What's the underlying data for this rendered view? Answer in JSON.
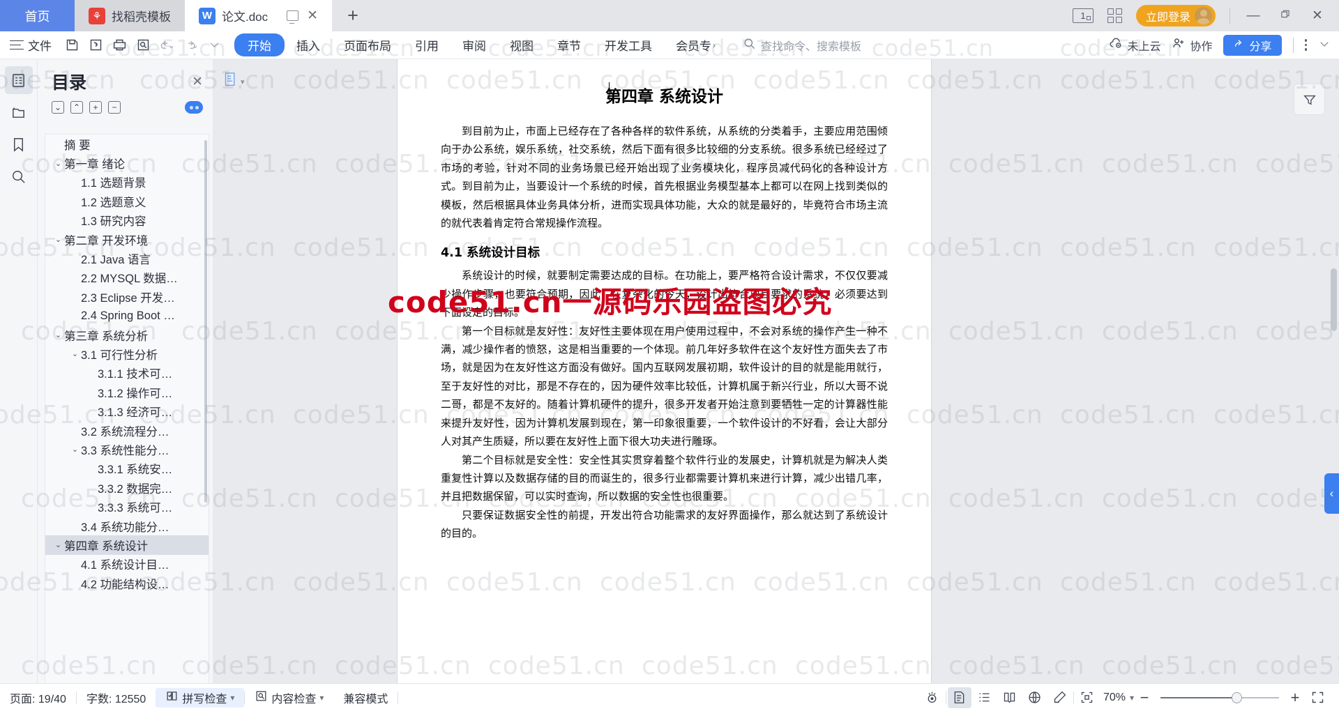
{
  "window": {
    "tabs": [
      {
        "label": "首页",
        "type": "home",
        "icon": "home-tab"
      },
      {
        "label": "找稻壳模板",
        "type": "inactive",
        "icon": "docer-icon"
      },
      {
        "label": "论文.doc",
        "type": "active",
        "icon": "wps-writer-icon"
      }
    ],
    "new_tab_label": "+",
    "close_label": "✕",
    "login_button": "立即登录",
    "minimize": "—",
    "restore": "❐",
    "close": "✕",
    "page_count_badge": "1"
  },
  "ribbon": {
    "file_label": "文件",
    "quick_icons": [
      "save-icon",
      "cloud-save-icon",
      "print-icon",
      "print-preview-icon",
      "undo-icon",
      "redo-icon",
      "customize-icon"
    ],
    "menus": [
      {
        "label": "开始",
        "active": true
      },
      {
        "label": "插入",
        "active": false
      },
      {
        "label": "页面布局",
        "active": false
      },
      {
        "label": "引用",
        "active": false
      },
      {
        "label": "审阅",
        "active": false
      },
      {
        "label": "视图",
        "active": false
      },
      {
        "label": "章节",
        "active": false
      },
      {
        "label": "开发工具",
        "active": false
      },
      {
        "label": "会员专",
        "active": false
      }
    ],
    "search_placeholder": "查找命令、搜索模板",
    "cloud_status": "未上云",
    "collab_label": "协作",
    "share_label": "分享"
  },
  "rail": {
    "items": [
      {
        "name": "document-outline",
        "icon": "outline-icon",
        "active": true
      },
      {
        "name": "thumbnail-pane",
        "icon": "thumbnail-icon",
        "active": false
      },
      {
        "name": "bookmark-pane",
        "icon": "bookmark-icon",
        "active": false
      },
      {
        "name": "search-pane",
        "icon": "search-icon",
        "active": false
      }
    ]
  },
  "toc": {
    "title": "目录",
    "close_label": "✕",
    "tools": [
      {
        "name": "expand-down-button",
        "glyph": "⌄"
      },
      {
        "name": "collapse-up-button",
        "glyph": "⌃"
      },
      {
        "name": "expand-all-button",
        "glyph": "+"
      },
      {
        "name": "collapse-all-button",
        "glyph": "−"
      }
    ],
    "items": [
      {
        "label": "摘  要",
        "level": 1,
        "caret": "",
        "selected": false
      },
      {
        "label": "第一章 绪论",
        "level": 1,
        "caret": "⌄",
        "selected": false
      },
      {
        "label": "1.1 选题背景",
        "level": 2,
        "caret": "",
        "selected": false
      },
      {
        "label": "1.2 选题意义",
        "level": 2,
        "caret": "",
        "selected": false
      },
      {
        "label": "1.3 研究内容",
        "level": 2,
        "caret": "",
        "selected": false
      },
      {
        "label": "第二章 开发环境",
        "level": 1,
        "caret": "⌄",
        "selected": false
      },
      {
        "label": "2.1 Java 语言",
        "level": 2,
        "caret": "",
        "selected": false
      },
      {
        "label": "2.2 MYSQL 数据…",
        "level": 2,
        "caret": "",
        "selected": false
      },
      {
        "label": "2.3 Eclipse 开发…",
        "level": 2,
        "caret": "",
        "selected": false
      },
      {
        "label": "2.4 Spring Boot …",
        "level": 2,
        "caret": "",
        "selected": false
      },
      {
        "label": "第三章 系统分析",
        "level": 1,
        "caret": "⌄",
        "selected": false
      },
      {
        "label": "3.1 可行性分析",
        "level": 2,
        "caret": "⌄",
        "selected": false
      },
      {
        "label": "3.1.1 技术可…",
        "level": 3,
        "caret": "",
        "selected": false
      },
      {
        "label": "3.1.2 操作可…",
        "level": 3,
        "caret": "",
        "selected": false
      },
      {
        "label": "3.1.3 经济可…",
        "level": 3,
        "caret": "",
        "selected": false
      },
      {
        "label": "3.2 系统流程分…",
        "level": 2,
        "caret": "",
        "selected": false
      },
      {
        "label": "3.3 系统性能分…",
        "level": 2,
        "caret": "⌄",
        "selected": false
      },
      {
        "label": "3.3.1 系统安…",
        "level": 3,
        "caret": "",
        "selected": false
      },
      {
        "label": "3.3.2 数据完…",
        "level": 3,
        "caret": "",
        "selected": false
      },
      {
        "label": "3.3.3 系统可…",
        "level": 3,
        "caret": "",
        "selected": false
      },
      {
        "label": "3.4 系统功能分…",
        "level": 2,
        "caret": "",
        "selected": false
      },
      {
        "label": "第四章 系统设计",
        "level": 1,
        "caret": "⌄",
        "selected": true
      },
      {
        "label": "4.1 系统设计目…",
        "level": 2,
        "caret": "",
        "selected": false
      },
      {
        "label": "4.2 功能结构设…",
        "level": 2,
        "caret": "",
        "selected": false
      }
    ]
  },
  "document": {
    "heading1": "第四章  系统设计",
    "paragraphs": [
      "到目前为止，市面上已经存在了各种各样的软件系统，从系统的分类着手，主要应用范围倾向于办公系统，娱乐系统，社交系统，然后下面有很多比较细的分支系统。很多系统已经经过了市场的考验，针对不同的业务场景已经开始出现了业务模块化，程序员减代码化的各种设计方式。到目前为止，当要设计一个系统的时候，首先根据业务模型基本上都可以在网上找到类似的模板，然后根据具体业务具体分析，进而实现具体功能，大众的就是最好的，毕竟符合市场主流的就代表着肯定符合常规操作流程。"
    ],
    "heading2": "4.1  系统设计目标",
    "paragraphs2": [
      "系统设计的时候，就要制定需要达成的目标。在功能上，要严格符合设计需求，不仅仅要减少操作步骤，也要符合预期，因此，在复杂化的今天，设计出符合项目要求的系统，必须要达到下面设定的目标。",
      "第一个目标就是友好性：友好性主要体现在用户使用过程中，不会对系统的操作产生一种不满，减少操作者的愤怒，这是相当重要的一个体现。前几年好多软件在这个友好性方面失去了市场，就是因为在友好性这方面没有做好。国内互联网发展初期，软件设计的目的就是能用就行，至于友好性的对比，那是不存在的，因为硬件效率比较低，计算机属于新兴行业，所以大哥不说二哥，都是不友好的。随着计算机硬件的提升，很多开发者开始注意到要牺牲一定的计算器性能来提升友好性，因为计算机发展到现在，第一印象很重要，一个软件设计的不好看，会让大部分人对其产生质疑，所以要在友好性上面下很大功夫进行雕琢。",
      "第二个目标就是安全性：安全性其实贯穿着整个软件行业的发展史，计算机就是为解决人类重复性计算以及数据存储的目的而诞生的，很多行业都需要计算机来进行计算，减少出错几率，并且把数据保留，可以实时查询，所以数据的安全性也很重要。",
      "只要保证数据安全性的前提，开发出符合功能需求的友好界面操作，那么就达到了系统设计的目的。"
    ]
  },
  "watermarks": {
    "text": "code51.cn",
    "red_text": "code51.cn一源码乐园盗图必究",
    "color": "#d0021b"
  },
  "status": {
    "page": "页面: 19/40",
    "words": "字数: 12550",
    "spellcheck": "拼写检查",
    "contentcheck": "内容检查",
    "compat": "兼容模式",
    "view_icons": [
      "focus-mode-icon",
      "page-view-icon",
      "outline-view-icon",
      "reading-view-icon",
      "web-view-icon",
      "edit-pen-icon"
    ],
    "fit_icon": "fit-page-icon",
    "zoom": "70%",
    "zoom_out": "−",
    "zoom_in": "+",
    "fullscreen_icon": "fullscreen-icon"
  }
}
